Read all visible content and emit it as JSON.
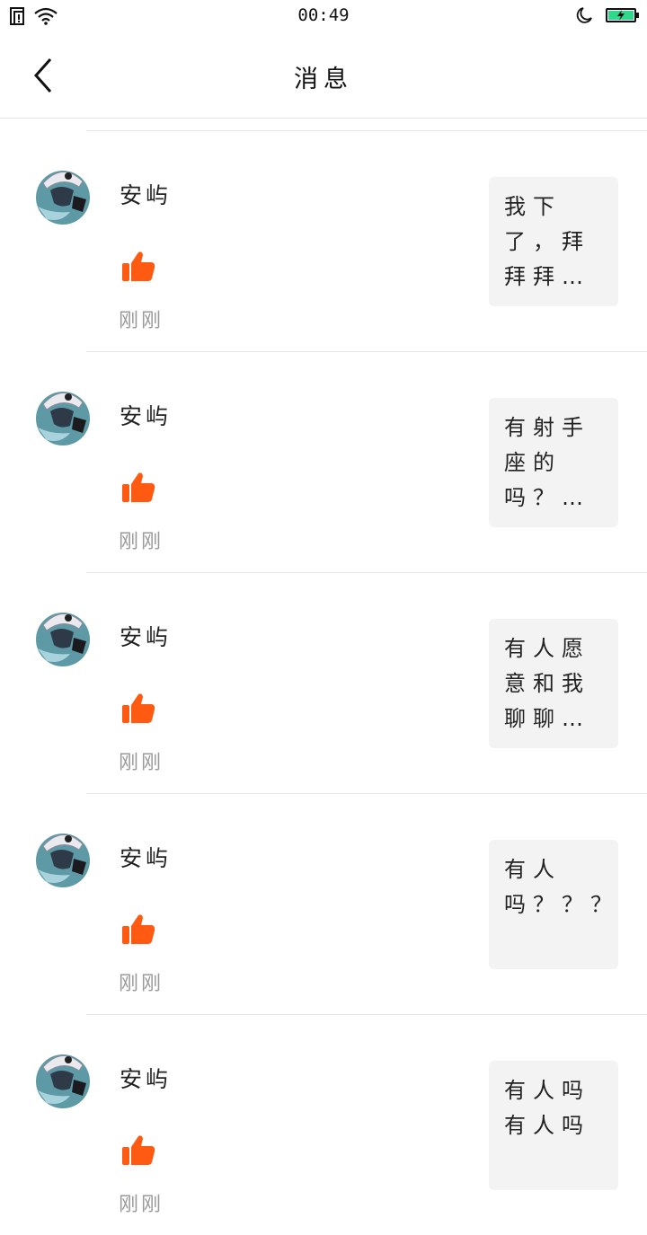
{
  "status_bar": {
    "time": "00:49"
  },
  "header": {
    "title": "消息"
  },
  "colors": {
    "like": "#ff5a12",
    "battery": "#2fd88a"
  },
  "messages": [
    {
      "name": "安屿",
      "time": "刚刚",
      "preview": "我下了，拜拜拜…"
    },
    {
      "name": "安屿",
      "time": "刚刚",
      "preview": "有射手座的吗？…"
    },
    {
      "name": "安屿",
      "time": "刚刚",
      "preview": "有人愿意和我聊聊…"
    },
    {
      "name": "安屿",
      "time": "刚刚",
      "preview": "有人吗？？？？…"
    },
    {
      "name": "安屿",
      "time": "刚刚",
      "preview": "有人吗有人吗"
    }
  ]
}
